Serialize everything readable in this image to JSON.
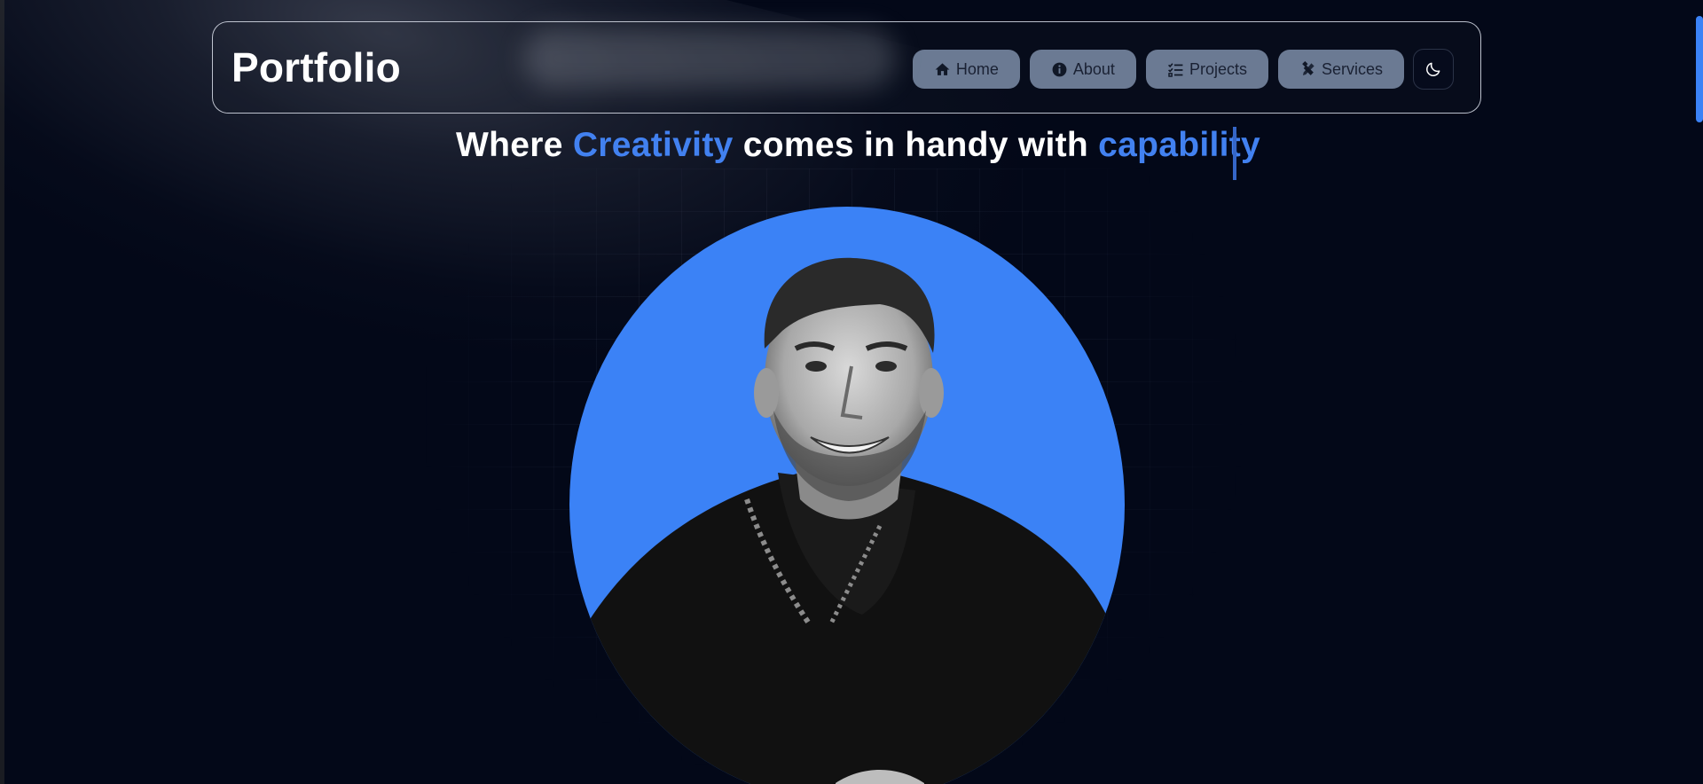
{
  "navbar": {
    "brand": "Portfolio",
    "items": [
      {
        "label": "Home",
        "icon": "home-icon"
      },
      {
        "label": "About",
        "icon": "info-circle-icon"
      },
      {
        "label": "Projects",
        "icon": "checklist-icon"
      },
      {
        "label": "Services",
        "icon": "tools-icon"
      }
    ],
    "theme_toggle_icon": "moon-icon"
  },
  "hero": {
    "headline_part1": "Where",
    "headline_accent1": "Creativity",
    "headline_part2": "comes in handy with",
    "headline_accent2": "capability"
  },
  "colors": {
    "background": "#030818",
    "accent": "#4281f0",
    "nav_button": "#6b7a93",
    "avatar_background": "#3b82f6"
  }
}
